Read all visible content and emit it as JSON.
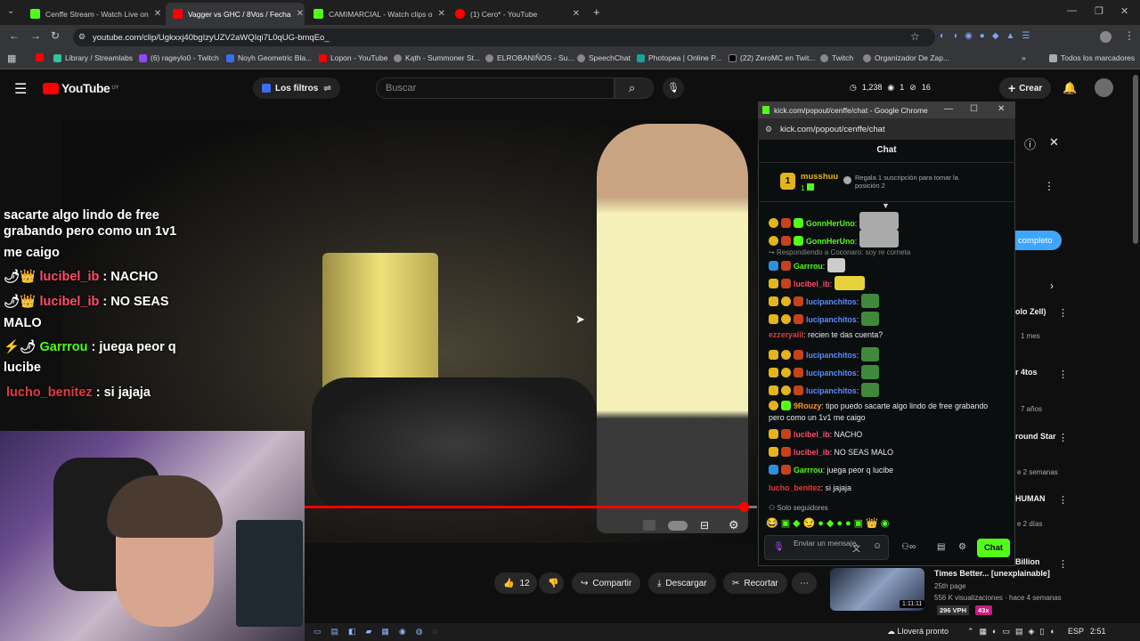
{
  "browser": {
    "tabs": [
      {
        "label": "Cenffe Stream - Watch Live on",
        "color": "#53fc18"
      },
      {
        "label": "Vagger vs GHC / 8Vos / Fecha",
        "color": "#ff0000"
      },
      {
        "label": "CAMIMARCIAL - Watch clips o",
        "color": "#53fc18"
      },
      {
        "label": "(1) Cero* - YouTube",
        "color": "#ff0000"
      }
    ],
    "url": "youtube.com/clip/Ugkxxj40bgIzyUZV2aWQIqi7L0qUG-bmqEo_",
    "bookmarks": [
      "Library / Streamlabs",
      "(6) rageylo0 - Twitch",
      "Noyh Geometric Bla...",
      "Lopon - YouTube",
      "Kąth - Summoner St...",
      "ELROBANIÑOS - Su...",
      "SpeechChat",
      "Photopea | Online P...",
      "(22) ZeroMC en Twit...",
      "Twitch",
      "Organizador De Zap..."
    ],
    "bookmarks_all": "Todos los marcadores"
  },
  "youtube": {
    "logo": "YouTube",
    "region": "UY",
    "filter": "Los filtros",
    "search_placeholder": "Buscar",
    "stats": {
      "views": "1,238",
      "a": "1",
      "b": "16"
    },
    "create": "Crear",
    "likes": "12",
    "share": "Compartir",
    "download": "Descargar",
    "clip": "Recortar",
    "completo": "completo"
  },
  "overlay_chat": [
    {
      "text": "sacarte algo lindo de free"
    },
    {
      "text": "grabando pero como un 1v1"
    },
    {
      "text": "me caigo"
    },
    {
      "user": "lucibel_ib",
      "msg": " : NACHO",
      "color": "#ff4d6a"
    },
    {
      "user": "lucibel_ib",
      "msg": " : NO SEAS",
      "color": "#ff4d6a"
    },
    {
      "text": "MALO"
    },
    {
      "user": "Garrrou",
      "msg": " : juega peor q",
      "color": "#53fc18"
    },
    {
      "text": "lucibe"
    },
    {
      "user": "lucho_benitez",
      "msg": " : si jajaja",
      "color": "#e23a3a"
    }
  ],
  "popup": {
    "title": "kick.com/popout/cenffe/chat - Google Chrome",
    "url": "kick.com/popout/cenffe/chat",
    "header": "Chat",
    "top_user": "musshuu",
    "top_count": "1",
    "top_note_1": "Regala 1 suscripción para tomar la",
    "top_note_2": "posición 2",
    "reply_note": "Respondiendo a Coconaro: soy re corneta",
    "messages": [
      {
        "user": "GonnHerUno",
        "msg": ":",
        "color": "#53fc18"
      },
      {
        "user": "GonnHerUno",
        "msg": ":",
        "color": "#53fc18"
      },
      {
        "user": "Garrrou",
        "msg": ":",
        "color": "#53fc18"
      },
      {
        "user": "lucibel_ib",
        "msg": ":",
        "color": "#ff4d6a"
      },
      {
        "user": "lucipanchitos",
        "msg": ":",
        "color": "#5b8cff"
      },
      {
        "user": "lucipanchitos",
        "msg": ":",
        "color": "#5b8cff"
      },
      {
        "user": "ezzeryalil",
        "msg": ": recien te das cuenta?",
        "color": "#e23a3a"
      },
      {
        "user": "lucipanchitos",
        "msg": ":",
        "color": "#5b8cff"
      },
      {
        "user": "lucipanchitos",
        "msg": ":",
        "color": "#5b8cff"
      },
      {
        "user": "lucipanchitos",
        "msg": ":",
        "color": "#5b8cff"
      },
      {
        "user": "9Rouzy",
        "msg": ": tipo puedo sacarte algo lindo de free grabando",
        "color": "#ff9b1a"
      },
      {
        "user": "",
        "msg": "pero como un 1v1 me caigo",
        "color": "#fff"
      },
      {
        "user": "lucibel_ib",
        "msg": ": NACHO",
        "color": "#ff4d6a"
      },
      {
        "user": "lucibel_ib",
        "msg": ": NO SEAS MALO",
        "color": "#ff4d6a"
      },
      {
        "user": "Garrrou",
        "msg": ": juega peor q lucibe",
        "color": "#53fc18"
      },
      {
        "user": "lucho_benitez",
        "msg": ": si jajaja",
        "color": "#e23a3a"
      }
    ],
    "followers_only": "Solo seguidores",
    "input_placeholder": "Enviar un mensaje",
    "chat_button": "Chat"
  },
  "sidebar": {
    "items": [
      "olo Zell)",
      "1 mes",
      "r 4tos",
      "7 años",
      "round Star",
      "e 2 semanas",
      "HUMAN",
      "e 2 días",
      "Billion",
      "Times Better... [unexplainable]",
      "25th page",
      "556 K visualizaciones · hace 4 semanas",
      "296 VPH",
      "43x"
    ],
    "duration": "1:11:11"
  },
  "taskbar": {
    "weather": "Lloverá pronto",
    "lang": "ESP",
    "time": "2:51"
  }
}
